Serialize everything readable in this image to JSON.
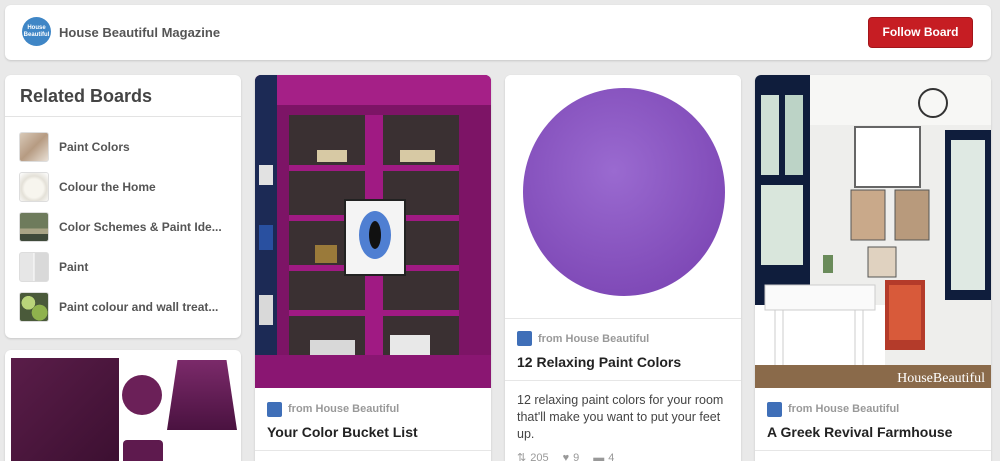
{
  "header": {
    "logo_text": "House Beautiful",
    "board_owner": "House Beautiful Magazine",
    "follow_label": "Follow Board"
  },
  "related": {
    "title": "Related Boards",
    "items": [
      {
        "label": "Paint Colors",
        "icon": "paint-swatch-thumb"
      },
      {
        "label": "Colour the Home",
        "icon": "white-bowl-thumb"
      },
      {
        "label": "Color Schemes & Paint Ide...",
        "icon": "swatch-grid-thumb"
      },
      {
        "label": "Paint",
        "icon": "paint-can-thumb"
      },
      {
        "label": "Paint colour and wall treat...",
        "icon": "green-swatch-thumb"
      }
    ]
  },
  "pins": [
    {
      "source": "from House Beautiful",
      "title": "Your Color Bucket List",
      "image": "magenta-bookcase"
    },
    {
      "source": "from House Beautiful",
      "title": "12 Relaxing Paint Colors",
      "image": "purple-paint-circle",
      "description": "12 relaxing paint colors for your room that'll make you want to put your feet up.",
      "repins": "205",
      "likes": "9",
      "comments": "4"
    },
    {
      "source": "from House Beautiful",
      "title": "A Greek Revival Farmhouse",
      "image": "white-bathroom",
      "watermark": "HouseBeautiful"
    }
  ],
  "colors": {
    "accent": "#c61d23",
    "magenta": "#8a1a6a",
    "purple": "#8a55c0"
  }
}
